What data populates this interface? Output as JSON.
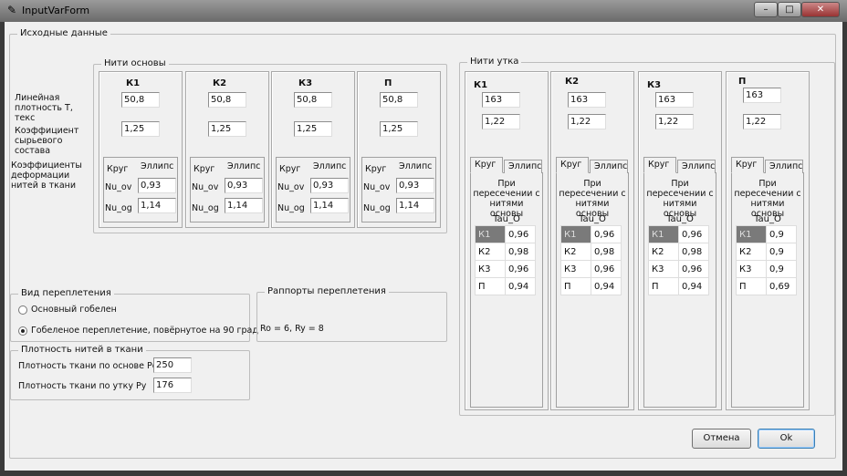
{
  "window": {
    "title": "InputVarForm",
    "min": "–",
    "max": "□",
    "close": "✕"
  },
  "source": {
    "label": "Исходные данные",
    "row_labels": {
      "density": "Линейная плотность Т, текс",
      "coef": "Коэффициент сырьевого состава",
      "deform": "Коэффициенты деформации нитей в ткани"
    }
  },
  "warp": {
    "label": "Нити основы",
    "tab_circle": "Круг",
    "tab_ellipse": "Эллипс",
    "nu_ov": "Nu_ov",
    "nu_og": "Nu_og",
    "columns": [
      {
        "name": "К1",
        "density": "50,8",
        "coef": "1,25",
        "nu_ov": "0,93",
        "nu_og": "1,14"
      },
      {
        "name": "К2",
        "density": "50,8",
        "coef": "1,25",
        "nu_ov": "0,93",
        "nu_og": "1,14"
      },
      {
        "name": "К3",
        "density": "50,8",
        "coef": "1,25",
        "nu_ov": "0,93",
        "nu_og": "1,14"
      },
      {
        "name": "П",
        "density": "50,8",
        "coef": "1,25",
        "nu_ov": "0,93",
        "nu_og": "1,14"
      }
    ]
  },
  "weft": {
    "label": "Нити утка",
    "tab_circle": "Круг",
    "tab_ellipse": "Эллипс",
    "caption": "При пересечении с нитями основы",
    "tau": "Tau_O",
    "columns": [
      {
        "name": "К1",
        "density": "163",
        "coef": "1,22",
        "rows": [
          [
            "К1",
            "0,96"
          ],
          [
            "К2",
            "0,98"
          ],
          [
            "К3",
            "0,96"
          ],
          [
            "П",
            "0,94"
          ]
        ]
      },
      {
        "name": "К2",
        "density": "163",
        "coef": "1,22",
        "rows": [
          [
            "К1",
            "0,96"
          ],
          [
            "К2",
            "0,98"
          ],
          [
            "К3",
            "0,96"
          ],
          [
            "П",
            "0,94"
          ]
        ]
      },
      {
        "name": "К3",
        "density": "163",
        "coef": "1,22",
        "rows": [
          [
            "К1",
            "0,96"
          ],
          [
            "К2",
            "0,98"
          ],
          [
            "К3",
            "0,96"
          ],
          [
            "П",
            "0,94"
          ]
        ]
      },
      {
        "name": "П",
        "density": "163",
        "coef": "1,22",
        "rows": [
          [
            "К1",
            "0,9"
          ],
          [
            "К2",
            "0,9"
          ],
          [
            "К3",
            "0,9"
          ],
          [
            "П",
            "0,69"
          ]
        ]
      }
    ]
  },
  "weave": {
    "label": "Вид переплетения",
    "options": [
      "Основный гобелен",
      "Гобеленое переплетение, повёрнутое на 90 град"
    ],
    "selected": 1
  },
  "repeats": {
    "label": "Раппорты переплетения",
    "value": "Ro = 6, Ry = 8"
  },
  "thread_density": {
    "label": "Плотность нитей в ткани",
    "warp_label": "Плотность ткани по основе Ро",
    "warp_value": "250",
    "weft_label": "Плотность ткани по утку Ру",
    "weft_value": "176"
  },
  "buttons": {
    "cancel": "Отмена",
    "ok": "Ok"
  }
}
